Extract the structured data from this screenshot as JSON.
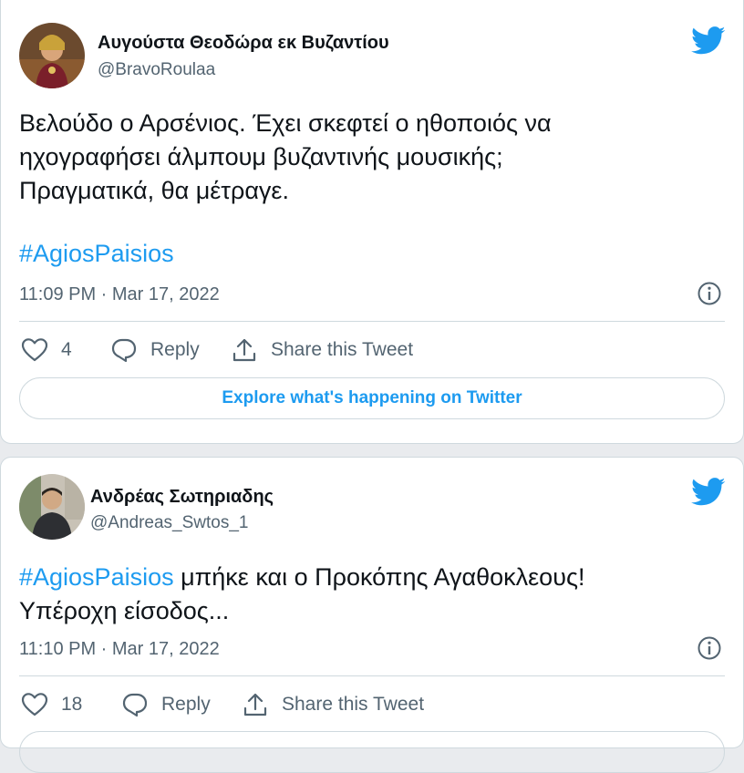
{
  "tweets": [
    {
      "author_name": "Αυγούστα Θεοδώρα εκ Βυζαντίου",
      "author_handle": "@BravoRoulaa",
      "text_lines": [
        "Βελούδο ο Αρσένιος. Έχει σκεφτεί ο ηθοποιός να",
        "ηχογραφήσει άλμπουμ βυζαντινής μουσικής;",
        "Πραγματικά, θα μέτραγε."
      ],
      "hashtag": "#AgiosPaisios",
      "timestamp": "11:09 PM · Mar 17, 2022",
      "like_count": "4",
      "reply_label": "Reply",
      "share_label": "Share this Tweet",
      "explore_label": "Explore what's happening on Twitter"
    },
    {
      "author_name": "Ανδρέας Σωτηριαδης",
      "author_handle": "@Andreas_Swtos_1",
      "hashtag": "#AgiosPaisios",
      "text_rest": " μπήκε και ο Προκόπης Αγαθοκλεους!",
      "text_line2": "Υπέροχη είσοδος...",
      "timestamp": "11:10 PM · Mar 17, 2022",
      "like_count": "18",
      "reply_label": "Reply",
      "share_label": "Share this Tweet"
    }
  ],
  "colors": {
    "accent": "#1d9bf0",
    "muted": "#536471",
    "border": "#cfd9de"
  },
  "icons": [
    "twitter-bird-icon",
    "info-icon",
    "heart-icon",
    "reply-icon",
    "share-icon"
  ]
}
